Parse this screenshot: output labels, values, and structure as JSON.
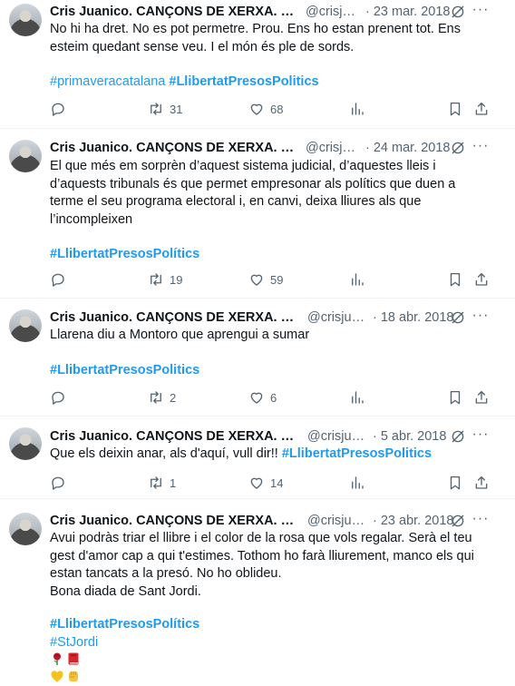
{
  "tweets": [
    {
      "name": "Cris Juanico. CANÇONS DE XERXA. Lli…",
      "handle": "@crisju…",
      "date": "23 mar. 2018",
      "lines": [
        "No hi ha dret. No es pot permetre. Prou. Ens ho estan prenent tot. Ens",
        "esteim quedant sense veu. I el món és ple de sords."
      ],
      "hashtags": [
        "#primaveracatalana",
        "#LlibertatPresosPolitics"
      ],
      "replies": "",
      "retweets": "31",
      "likes": "68"
    },
    {
      "name": "Cris Juanico. CANÇONS DE XERXA. Lli…",
      "handle": "@crisju…",
      "date": "24 mar. 2018",
      "lines": [
        "El que més em sorprèn d’aquest sistema judicial, d’aquestes lleis i",
        "d’aquests tribunals és que permet empresonar als polítics que duen a",
        "terme el seu programa electoral i, en canvi, deixa lliures als que",
        "l’incompleixen"
      ],
      "hashtags": [
        "#LlibertatPresosPolítics"
      ],
      "replies": "",
      "retweets": "19",
      "likes": "59"
    },
    {
      "name": "Cris Juanico. CANÇONS DE XERXA. Llib…",
      "handle": "@crisjua…",
      "date": "18 abr. 2018",
      "lines": [
        "Llarena diu a Montoro que aprengui a sumar"
      ],
      "hashtags": [
        "#LlibertatPresosPolitics"
      ],
      "replies": "",
      "retweets": "2",
      "likes": "6"
    },
    {
      "name": "Cris Juanico. CANÇONS DE XERXA. Llib…",
      "handle": "@crisjua…",
      "date": "5 abr. 2018",
      "text_prefix": "Que els deixin anar, als d'aquí, vull dir!! ",
      "inline_hashtag": "#LlibertatPresosPolitics",
      "replies": "",
      "retweets": "1",
      "likes": "14"
    },
    {
      "name": "Cris Juanico. CANÇONS DE XERXA. Llib…",
      "handle": "@crisjua…",
      "date": "23 abr. 2018",
      "lines": [
        "Avui podràs triar el llibre i el color de la rosa que vols regalar. Serà el teu",
        "gest d'amor cap a qui t'estimes. Tothom ho farà lliurement, manco els qui",
        "estan tancats a la presó. No ho oblideu.",
        "Bona diada de Sant Jordi."
      ],
      "hashtags": [
        "#LlibertatPresosPolítics",
        "#StJordi"
      ],
      "emojis_row1": [
        "rose-emoji",
        "book-emoji"
      ],
      "emojis_row2": [
        "yellow-heart-emoji",
        "raised-fist-emoji"
      ]
    }
  ],
  "icons": [
    "more-icon",
    "grok-icon",
    "reply-icon",
    "retweet-icon",
    "like-icon",
    "views-icon",
    "bookmark-icon",
    "share-icon"
  ],
  "colors": {
    "link": "#1d9bf0",
    "muted": "#536471",
    "text": "#0f1419",
    "border": "#eff3f4"
  }
}
